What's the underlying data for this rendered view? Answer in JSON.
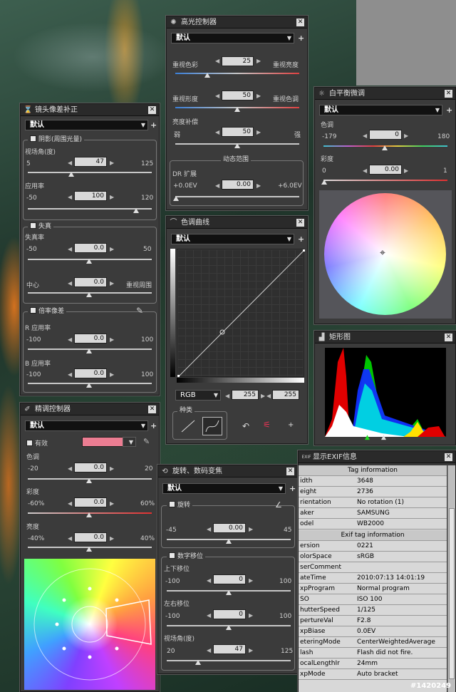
{
  "colors": {
    "panel": "#3b3b3b",
    "title_bar": "#2a2a2a",
    "swatch": "#ec7d92"
  },
  "highlight": {
    "title": "高光控制器",
    "preset": "默认",
    "left1": "重视色彩",
    "right1": "重视亮度",
    "val1": "25",
    "left2": "重视形度",
    "right2": "重视色调",
    "val2": "50",
    "bright_label": "亮度补偿",
    "dark": "弱",
    "strong": "强",
    "val3": "50",
    "dr_group": "动态范围",
    "dr_label": "DR 扩展",
    "dr_min": "+0.0EV",
    "dr_max": "+6.0EV",
    "dr_val": "0.00"
  },
  "lens": {
    "title": "镜头像差补正",
    "preset": "默认",
    "vignette": "阴影(周围光量)",
    "fov": "视场角(度)",
    "fov_min": "5",
    "fov_max": "125",
    "fov_val": "47",
    "rate": "应用率",
    "rate_min": "-50",
    "rate_max": "120",
    "rate_val": "100",
    "distort": "失真",
    "distort_rate": "失真率",
    "d_min": "-50",
    "d_max": "50",
    "d_val": "0.0",
    "center": "中心",
    "periphery": "重视周围",
    "c_val": "0.0",
    "chroma": "倍率像差",
    "r_rate": "R 应用率",
    "r_min": "-100",
    "r_max": "100",
    "r_val": "0.0",
    "b_rate": "B 应用率",
    "b_min": "-100",
    "b_max": "100",
    "b_val": "0.0"
  },
  "curve": {
    "title": "色调曲线",
    "preset": "默认",
    "channel": "RGB",
    "in_val": "255",
    "out_val": "255",
    "kind": "种类"
  },
  "wb": {
    "title": "白平衡微调",
    "preset": "默认",
    "tint": "色调",
    "t_min": "-179",
    "t_max": "180",
    "t_val": "0",
    "sat": "彩度",
    "s_min": "0",
    "s_max": "1",
    "s_val": "0.00"
  },
  "hist": {
    "title": "矩形图"
  },
  "fine": {
    "title": "精调控制器",
    "preset": "默认",
    "enabled": "有效",
    "hue": "色调",
    "h_min": "-20",
    "h_max": "20",
    "h_val": "0.0",
    "sat": "彩度",
    "s_min": "-60%",
    "s_max": "60%",
    "s_val": "0.0",
    "lum": "亮度",
    "l_min": "-40%",
    "l_max": "40%",
    "l_val": "0.0"
  },
  "rotate": {
    "title": "旋转、数码变焦",
    "preset": "默认",
    "rotate": "旋转",
    "r_min": "-45",
    "r_max": "45",
    "r_val": "0.00",
    "shift": "数字移位",
    "vert": "上下移位",
    "v_min": "-100",
    "v_max": "100",
    "v_val": "0",
    "horiz": "左右移位",
    "hz_min": "-100",
    "hz_max": "100",
    "hz_val": "0",
    "fov": "视场角(度)",
    "f_min": "20",
    "f_max": "125",
    "f_val": "47"
  },
  "exif": {
    "title": "显示EXIF信息",
    "sec1": "Tag information",
    "sec2": "Exif tag information",
    "rows1": [
      [
        "idth",
        "3648"
      ],
      [
        "eight",
        "2736"
      ],
      [
        "rientation",
        "No rotation (1)"
      ],
      [
        "aker",
        "SAMSUNG"
      ],
      [
        "odel",
        "WB2000"
      ]
    ],
    "rows2": [
      [
        "ersion",
        "0221"
      ],
      [
        "olorSpace",
        "sRGB"
      ],
      [
        "serComment",
        ""
      ],
      [
        "ateTime",
        "2010:07:13 14:01:19"
      ],
      [
        "xpProgram",
        "Normal program"
      ],
      [
        "SO",
        "ISO 100"
      ],
      [
        "hutterSpeed",
        "1/125"
      ],
      [
        "pertureVal",
        "F2.8"
      ],
      [
        "xpBiase",
        "0.0EV"
      ],
      [
        "eteringMode",
        "CenterWeightedAverage"
      ],
      [
        "lash",
        "Flash did not fire."
      ],
      [
        "ocalLengthIr",
        "24mm"
      ],
      [
        "xpMode",
        "Auto bracket"
      ]
    ]
  },
  "watermark": "#1420249"
}
